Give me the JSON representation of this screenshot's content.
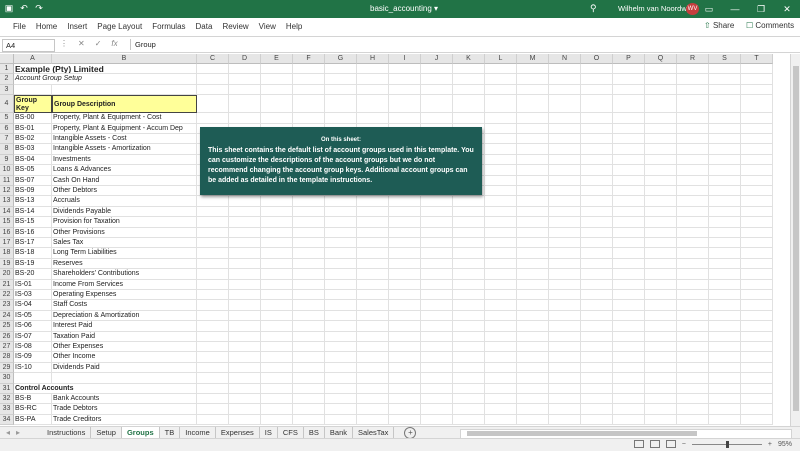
{
  "title_bar": {
    "document_name": "basic_accounting",
    "user_name": "Wilhelm van Noordwyk",
    "user_initials": "WV"
  },
  "ribbon": {
    "tabs": [
      "File",
      "Home",
      "Insert",
      "Page Layout",
      "Formulas",
      "Data",
      "Review",
      "View",
      "Help"
    ],
    "share_label": "Share",
    "comments_label": "Comments"
  },
  "formula_bar": {
    "name_box": "A4",
    "fx_label": "fx",
    "formula": "Group"
  },
  "columns": [
    "A",
    "B",
    "C",
    "D",
    "E",
    "F",
    "G",
    "H",
    "I",
    "J",
    "K",
    "L",
    "M",
    "N",
    "O",
    "P",
    "Q",
    "R",
    "S",
    "T"
  ],
  "rows": [
    {
      "n": "1",
      "a": "Example (Pty) Limited",
      "b": ""
    },
    {
      "n": "2",
      "a": "Account Group Setup",
      "b": ""
    },
    {
      "n": "3",
      "a": "",
      "b": ""
    },
    {
      "n": "4",
      "a": "Group Key",
      "b": "Group Description"
    },
    {
      "n": "5",
      "a": "BS-00",
      "b": "Property, Plant & Equipment - Cost"
    },
    {
      "n": "6",
      "a": "BS-01",
      "b": "Property, Plant & Equipment - Accum Dep"
    },
    {
      "n": "7",
      "a": "BS-02",
      "b": "Intangible Assets - Cost"
    },
    {
      "n": "8",
      "a": "BS-03",
      "b": "Intangible Assets - Amortization"
    },
    {
      "n": "9",
      "a": "BS-04",
      "b": "Investments"
    },
    {
      "n": "10",
      "a": "BS-05",
      "b": "Loans & Advances"
    },
    {
      "n": "11",
      "a": "BS-07",
      "b": "Cash On Hand"
    },
    {
      "n": "12",
      "a": "BS-09",
      "b": "Other Debtors"
    },
    {
      "n": "13",
      "a": "BS-13",
      "b": "Accruals"
    },
    {
      "n": "14",
      "a": "BS-14",
      "b": "Dividends Payable"
    },
    {
      "n": "15",
      "a": "BS-15",
      "b": "Provision for Taxation"
    },
    {
      "n": "16",
      "a": "BS-16",
      "b": "Other Provisions"
    },
    {
      "n": "17",
      "a": "BS-17",
      "b": "Sales Tax"
    },
    {
      "n": "18",
      "a": "BS-18",
      "b": "Long Term Liabilities"
    },
    {
      "n": "19",
      "a": "BS-19",
      "b": "Reserves"
    },
    {
      "n": "20",
      "a": "BS-20",
      "b": "Shareholders' Contributions"
    },
    {
      "n": "21",
      "a": "IS-01",
      "b": "Income From Services"
    },
    {
      "n": "22",
      "a": "IS-03",
      "b": "Operating Expenses"
    },
    {
      "n": "23",
      "a": "IS-04",
      "b": "Staff Costs"
    },
    {
      "n": "24",
      "a": "IS-05",
      "b": "Depreciation & Amortization"
    },
    {
      "n": "25",
      "a": "IS-06",
      "b": "Interest Paid"
    },
    {
      "n": "26",
      "a": "IS-07",
      "b": "Taxation Paid"
    },
    {
      "n": "27",
      "a": "IS-08",
      "b": "Other Expenses"
    },
    {
      "n": "28",
      "a": "IS-09",
      "b": "Other Income"
    },
    {
      "n": "29",
      "a": "IS-10",
      "b": "Dividends Paid"
    },
    {
      "n": "30",
      "a": "",
      "b": ""
    },
    {
      "n": "31",
      "a": "Control Accounts",
      "b": ""
    },
    {
      "n": "32",
      "a": "BS-B",
      "b": "Bank Accounts"
    },
    {
      "n": "33",
      "a": "BS-RC",
      "b": "Trade Debtors"
    },
    {
      "n": "34",
      "a": "BS-PA",
      "b": "Trade Creditors"
    }
  ],
  "note": {
    "heading": "On this sheet:",
    "body": "This sheet contains the default list of account groups used in this template. You can customize the descriptions of the account groups but we do not recommend changing the account group keys. Additional account groups can be added as detailed in the template instructions."
  },
  "sheet_tabs": [
    "Instructions",
    "Setup",
    "Groups",
    "TB",
    "Income",
    "Expenses",
    "IS",
    "CFS",
    "BS",
    "Bank",
    "SalesTax"
  ],
  "active_sheet": "Groups",
  "status": {
    "zoom": "95%"
  }
}
